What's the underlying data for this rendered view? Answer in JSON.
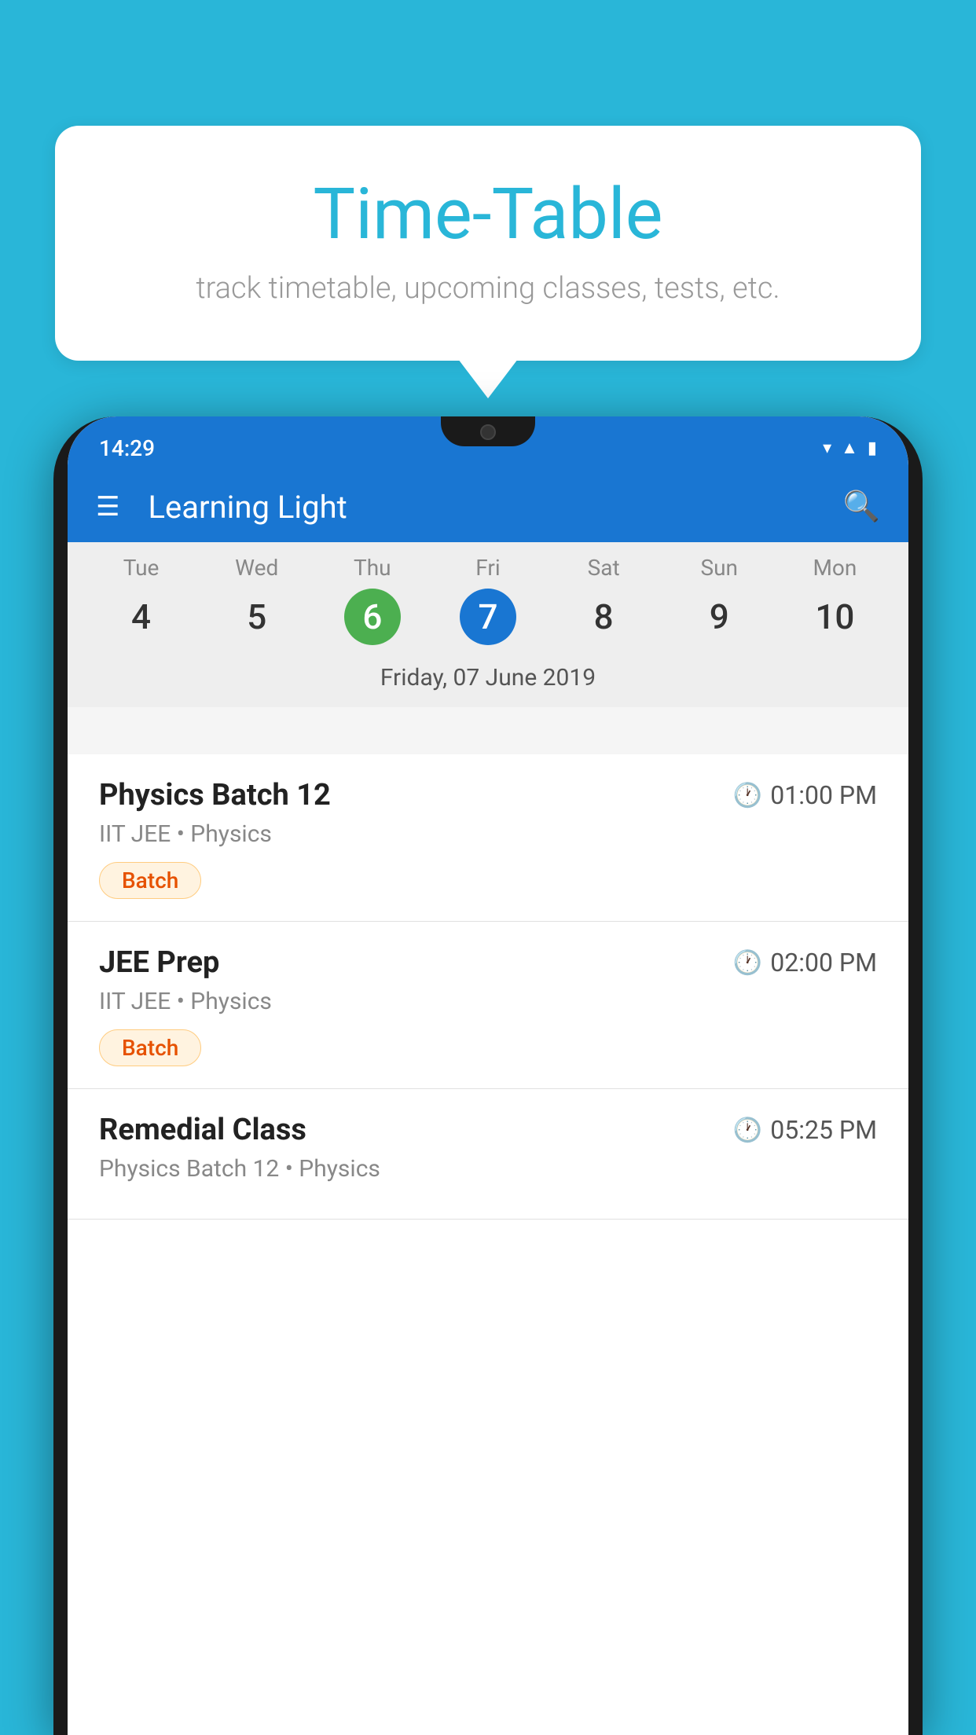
{
  "background_color": "#29b6d8",
  "speech_bubble": {
    "title": "Time-Table",
    "subtitle": "track timetable, upcoming classes, tests, etc."
  },
  "status_bar": {
    "time": "14:29"
  },
  "app_bar": {
    "title": "Learning Light"
  },
  "calendar": {
    "selected_date_label": "Friday, 07 June 2019",
    "days": [
      {
        "label": "Tue",
        "number": "4",
        "state": "normal"
      },
      {
        "label": "Wed",
        "number": "5",
        "state": "normal"
      },
      {
        "label": "Thu",
        "number": "6",
        "state": "today"
      },
      {
        "label": "Fri",
        "number": "7",
        "state": "selected"
      },
      {
        "label": "Sat",
        "number": "8",
        "state": "normal"
      },
      {
        "label": "Sun",
        "number": "9",
        "state": "normal"
      },
      {
        "label": "Mon",
        "number": "10",
        "state": "normal"
      }
    ]
  },
  "schedule": {
    "items": [
      {
        "title": "Physics Batch 12",
        "time": "01:00 PM",
        "subtitle": "IIT JEE • Physics",
        "badge": "Batch"
      },
      {
        "title": "JEE Prep",
        "time": "02:00 PM",
        "subtitle": "IIT JEE • Physics",
        "badge": "Batch"
      },
      {
        "title": "Remedial Class",
        "time": "05:25 PM",
        "subtitle": "Physics Batch 12 • Physics",
        "badge": null
      }
    ]
  }
}
